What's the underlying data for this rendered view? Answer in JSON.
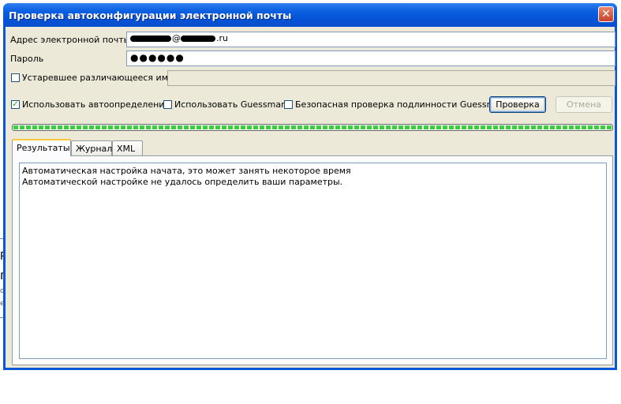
{
  "window": {
    "title": "Проверка автоконфигурации электронной почты"
  },
  "fields": {
    "email_label": "Адрес электронной почты",
    "email_suffix": ".ru",
    "email_at": "@",
    "password_label": "Пароль",
    "password_value": "●●●●●●",
    "legacy_name_label": "Устаревшее различающееся имя",
    "legacy_name_value": ""
  },
  "options": {
    "autodetect_label": "Использовать автоопределение",
    "autodetect_checked": true,
    "guessmart_label": "Использовать Guessmart",
    "guessmart_checked": false,
    "secure_guessmart_label": "Безопасная проверка подлинности Guessmart",
    "secure_guessmart_checked": false,
    "legacy_checked": false
  },
  "buttons": {
    "test": "Проверка",
    "cancel": "Отмена"
  },
  "progress": {
    "value": 1.0
  },
  "tabs": [
    {
      "label": "Результаты",
      "active": true
    },
    {
      "label": "Журнал",
      "active": false
    },
    {
      "label": "XML",
      "active": false
    }
  ],
  "results": {
    "lines": [
      "Автоматическая настройка начата, это может занять некоторое время",
      "Автоматической настройке не удалось определить ваши параметры."
    ]
  },
  "colors": {
    "titlebar": "#0a5fe0",
    "dialog_bg": "#ece9d8",
    "progress": "#37d03b",
    "active_tab_accent": "#ffc83c"
  }
}
